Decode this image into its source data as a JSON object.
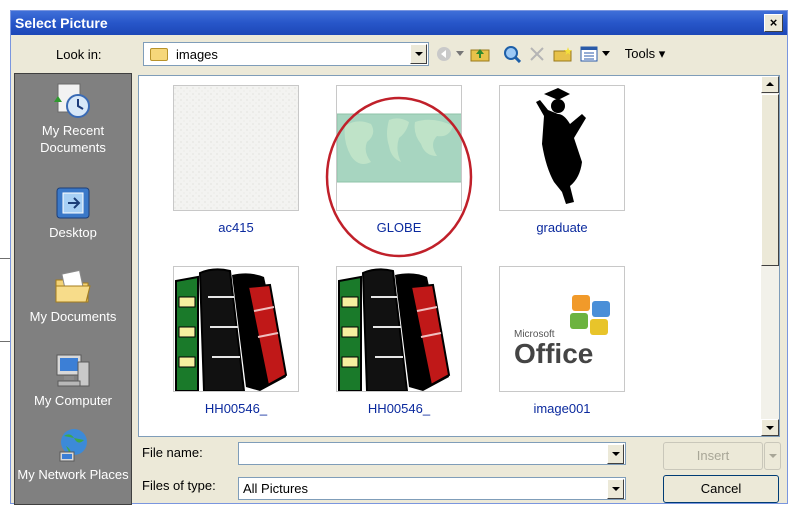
{
  "dialog": {
    "title": "Select Picture",
    "close_label": "×"
  },
  "lookin": {
    "label": "Look in:",
    "value": "images"
  },
  "toolbar": {
    "tools_label": "Tools ▾"
  },
  "places": [
    {
      "label": "My Recent Documents",
      "icon": "recent-documents-icon"
    },
    {
      "label": "Desktop",
      "icon": "desktop-icon"
    },
    {
      "label": "My Documents",
      "icon": "my-documents-icon"
    },
    {
      "label": "My Computer",
      "icon": "my-computer-icon"
    },
    {
      "label": "My Network Places",
      "icon": "network-places-icon"
    }
  ],
  "files": [
    {
      "name": "ac415"
    },
    {
      "name": "GLOBE"
    },
    {
      "name": "graduate"
    },
    {
      "name": "HH00546_"
    },
    {
      "name": "HH00546_"
    },
    {
      "name": "image001"
    }
  ],
  "thumb_text": {
    "microsoft": "Microsoft",
    "office": "Office"
  },
  "filename": {
    "label": "File name:",
    "value": ""
  },
  "filetype": {
    "label": "Files of type:",
    "value": "All Pictures"
  },
  "buttons": {
    "insert": "Insert",
    "cancel": "Cancel"
  },
  "colors": {
    "title_bar": "#2756c9",
    "highlight_circle": "#c0202a",
    "file_label": "#0b2a9e"
  }
}
